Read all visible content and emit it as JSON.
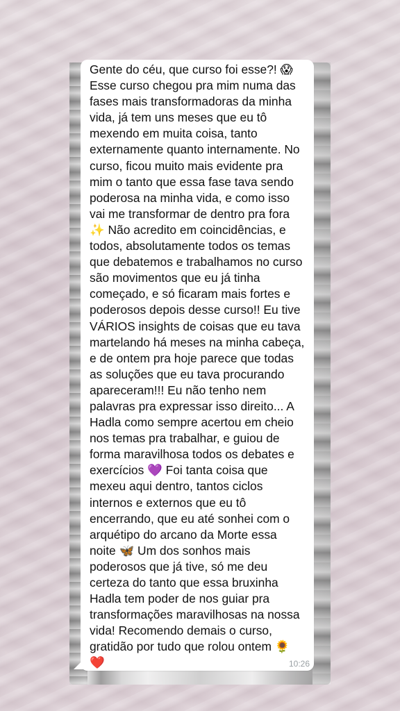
{
  "message": {
    "text": "Gente do céu, que curso foi esse?! 😱\nEsse curso chegou pra mim numa das\nfases mais transformadoras da minha\nvida, já tem uns meses que eu tô\nmexendo em muita coisa, tanto\nexternamente quanto internamente. No\ncurso, ficou muito mais evidente pra\nmim o tanto que essa fase tava sendo\npoderosa na minha vida, e como isso\nvai me transformar de dentro pra fora\n✨ Não acredito em coincidências, e\ntodos, absolutamente todos os temas\nque debatemos e trabalhamos no curso\nsão movimentos que eu já tinha\ncomeçado, e só ficaram mais fortes e\npoderosos depois desse curso!! Eu tive\nVÁRIOS insights de coisas que eu tava\nmartelando há meses na minha cabeça,\ne de ontem pra hoje parece que todas\nas soluções que eu tava procurando\napareceram!!! Eu não tenho nem\npalavras pra expressar isso direito... A\nHadla como sempre acertou em cheio\nnos temas pra trabalhar, e guiou de\nforma maravilhosa todos os debates e\nexercícios 💜 Foi tanta coisa que\nmexeu aqui dentro, tantos ciclos\ninternos e externos que eu tô\nencerrando, que eu até sonhei com o\narquétipo do arcano da Morte essa\nnoite 🦋 Um dos sonhos mais\npoderosos que já tive, só me deu\ncerteza do tanto que essa bruxinha\nHadla tem poder de nos guiar pra\ntransformações maravilhosas na nossa\nvida! Recomendo demais o curso,\ngratidão por tudo que rolou ontem 🌻\n❤️",
    "time": "10:26"
  },
  "colors": {
    "bubble": "#ffffff",
    "text": "#111111",
    "timestamp": "#9aa0a4",
    "background": "#d9cdd3"
  }
}
